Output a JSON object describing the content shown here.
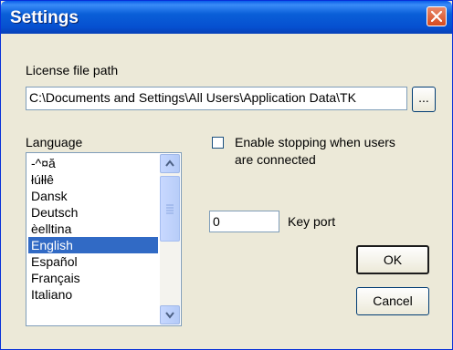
{
  "window": {
    "title": "Settings"
  },
  "license": {
    "label": "License file path",
    "value": "C:\\Documents and Settings\\All Users\\Application Data\\TK",
    "browse_label": "..."
  },
  "language": {
    "label": "Language",
    "items": [
      "-^¤ă",
      "łúłłê",
      "Dansk",
      "Deutsch",
      "èelltina",
      "English",
      "Español",
      "Français",
      "Italiano"
    ],
    "selected": "English"
  },
  "enable_stopping": {
    "label_line1": "Enable stopping when users",
    "label_line2": "are connected",
    "checked": false
  },
  "key_port": {
    "value": "0",
    "label": "Key port"
  },
  "buttons": {
    "ok": "OK",
    "cancel": "Cancel"
  }
}
